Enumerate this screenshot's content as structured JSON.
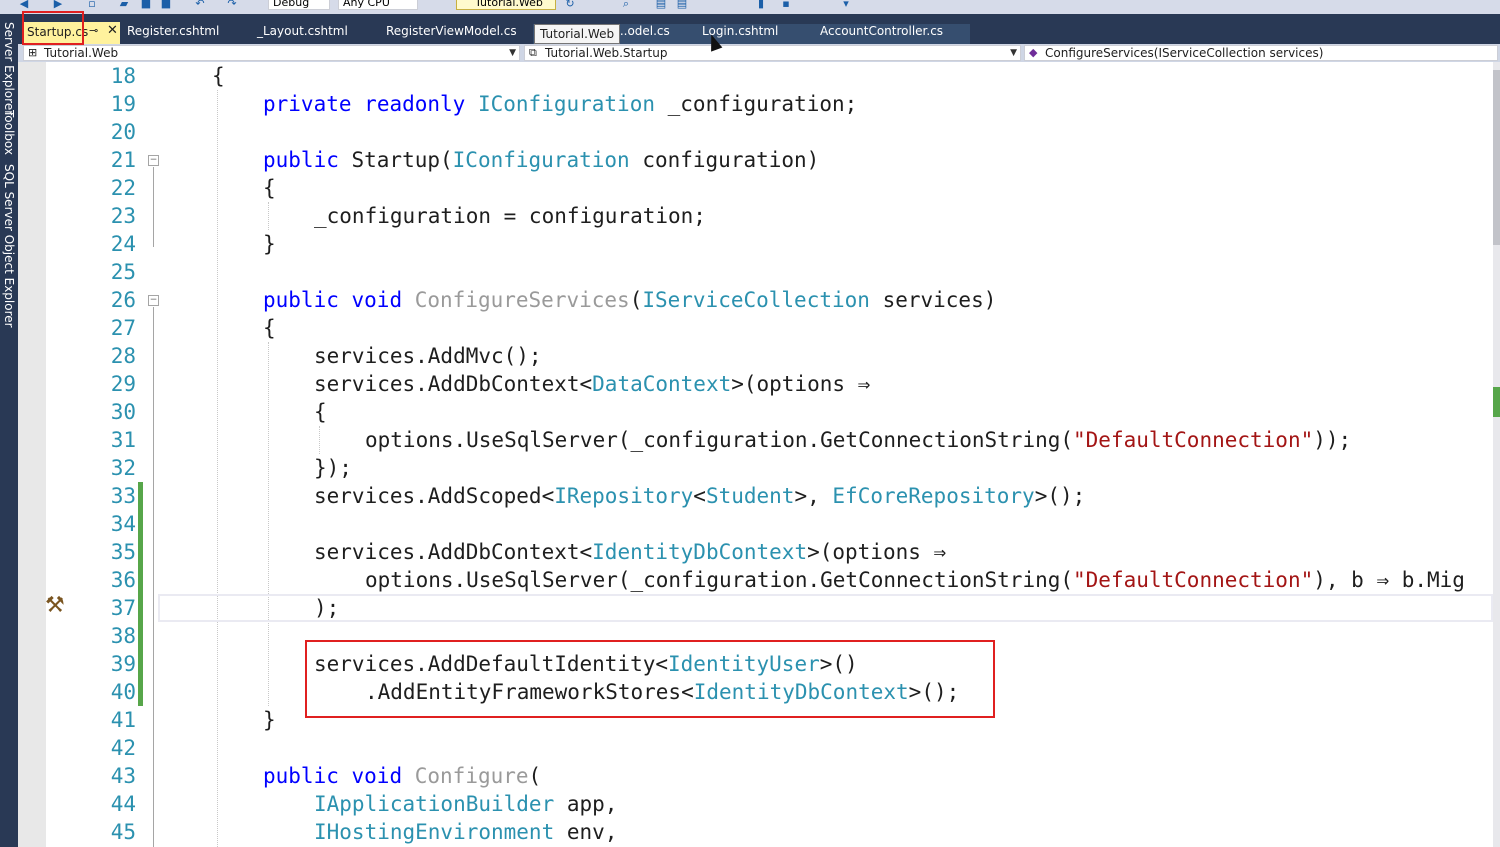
{
  "toolbar": {
    "config": "Debug",
    "platform": "Any CPU",
    "run_target": "Tutorial.Web"
  },
  "left_tools": [
    "Server Explorer",
    "Toolbox",
    "SQL Server Object Explorer"
  ],
  "tabs": {
    "active": "Startup.cs",
    "others": [
      "Register.cshtml",
      "_Layout.cshtml",
      "RegisterViewModel.cs",
      "...odel.cs",
      "Login.cshtml",
      "AccountController.cs"
    ],
    "tooltip": "Tutorial.Web"
  },
  "nav": {
    "project": "Tutorial.Web",
    "type": "Tutorial.Web.Startup",
    "member": "ConfigureServices(IServiceCollection services)"
  },
  "editor": {
    "line_numbers": [
      "18",
      "19",
      "20",
      "21",
      "22",
      "23",
      "24",
      "25",
      "26",
      "27",
      "28",
      "29",
      "30",
      "31",
      "32",
      "33",
      "34",
      "35",
      "36",
      "37",
      "38",
      "39",
      "40",
      "41",
      "42",
      "43",
      "44",
      "45"
    ],
    "code": {
      "l18": "{",
      "l19": "private readonly IConfiguration _configuration;",
      "l21": "public Startup(IConfiguration configuration)",
      "l22": "{",
      "l23": "_configuration = configuration;",
      "l24": "}",
      "l26": "public void ConfigureServices(IServiceCollection services)",
      "l27": "{",
      "l28": "services.AddMvc();",
      "l29": "services.AddDbContext<DataContext>(options ⇒",
      "l30": "{",
      "l31": "options.UseSqlServer(_configuration.GetConnectionString(\"DefaultConnection\"));",
      "l32": "});",
      "l33": "services.AddScoped<IRepository<Student>, EfCoreRepository>();",
      "l35": "services.AddDbContext<IdentityDbContext>(options ⇒",
      "l36": "options.UseSqlServer(_configuration.GetConnectionString(\"DefaultConnection\"), b ⇒ b.Mig",
      "l37": ");",
      "l39": "services.AddDefaultIdentity<IdentityUser>()",
      "l40": ".AddEntityFrameworkStores<IdentityDbContext>();",
      "l41": "}",
      "l43": "public void Configure(",
      "l44": "IApplicationBuilder app,",
      "l45": "IHostingEnvironment env,"
    }
  },
  "colors": {
    "keyword": "#0000ff",
    "type": "#2b91af",
    "string": "#a31515",
    "highlight_border": "#e02020",
    "change_bar": "#57a64a"
  }
}
